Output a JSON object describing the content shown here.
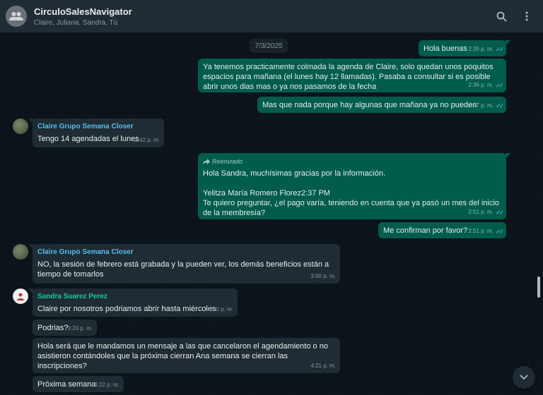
{
  "header": {
    "title": "CirculoSalesNavigator",
    "members": "Claire, Juliana, Sandra, Tú"
  },
  "date_separator": "7/3/2025",
  "messages": [
    {
      "dir": "out",
      "text": "Hola buenas",
      "time": "2:35 p. m."
    },
    {
      "dir": "out",
      "text": "Ya tenemos practicamente colmada la agenda de Claire, solo quedan unos poquitos espacios para mañana (el lunes hay 12 llamadas). Pasaba a consultar si es posible abrir unos dias mas o ya nos pasamos de la fecha",
      "time": "2:36 p. m."
    },
    {
      "dir": "out",
      "text": "Mas que nada porque hay algunas que mañana ya no pueden",
      "time": "2:37 p. m."
    },
    {
      "dir": "in",
      "sender": "Claire Grupo Semana Closer",
      "text": "Tengo 14 agendadas el lunes",
      "time": "2:42 p. m."
    },
    {
      "dir": "out",
      "forwarded_label": "Reenviado",
      "line1": "Hola Sandra, muchísimas gracias por la información.",
      "line2": "Yelitza María Romero Florez2:37 PM",
      "line3": "Te quiero preguntar, ¿el pago varía, teniendo en cuenta que ya pasó un mes del inicio de la membresía?",
      "time": "2:51 p. m."
    },
    {
      "dir": "out",
      "text": "Me confirman por favor?",
      "time": "2:51 p. m."
    },
    {
      "dir": "in",
      "sender": "Claire Grupo Semana Closer",
      "text": "NO, la sesión de febrero está grabada y la pueden ver, los demás beneficios están a tiempo de tomarlos",
      "time": "3:00 p. m."
    },
    {
      "dir": "in",
      "sender": "Sandra Suarez Perez",
      "text": "Claire por nosotros podriamos abrir hasta miércoles",
      "time": "3:20 p. m."
    },
    {
      "dir": "in",
      "text": "Podrias?",
      "time": "3:20 p. m."
    },
    {
      "dir": "in",
      "text": "Hola será que le mandamos un mensaje a las que cancelaron el agendamiento o no asistieron contándoles que la próxima cierran Ana semana se cierran las inscripciones?",
      "time": "4:21 p. m."
    },
    {
      "dir": "in",
      "text": "Próxima semana",
      "time": "4:22 p. m."
    }
  ],
  "colors": {
    "outgoing_bubble": "#005c4b",
    "incoming_bubble": "#202c33",
    "background": "#0b141a",
    "sender_claire": "#53bdeb",
    "sender_sandra": "#06cf9c",
    "read_ticks": "#53bdeb"
  },
  "icons": {
    "header_avatar": "group-icon",
    "search": "search-icon",
    "menu": "kebab-menu-icon",
    "forwarded": "forward-arrow-icon",
    "scroll_down": "chevron-down-icon"
  }
}
